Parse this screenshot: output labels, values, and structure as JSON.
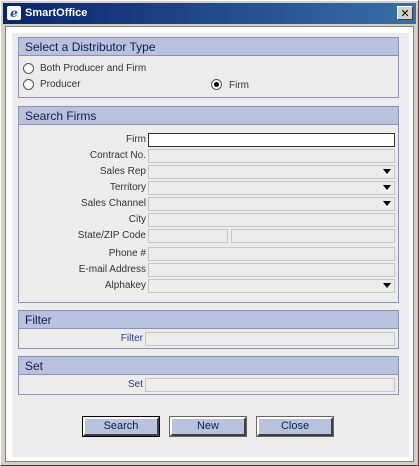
{
  "window": {
    "title": "SmartOffice",
    "close_glyph": "✕",
    "app_icon": "e"
  },
  "distributor": {
    "header": "Select a Distributor Type",
    "options": [
      {
        "label": "Both Producer and Firm",
        "checked": false
      },
      {
        "label": "Producer",
        "checked": false
      },
      {
        "label": "Firm",
        "checked": true
      }
    ]
  },
  "search": {
    "header": "Search Firms",
    "fields": {
      "firm": {
        "label": "Firm",
        "value": ""
      },
      "contract_no": {
        "label": "Contract No.",
        "value": ""
      },
      "sales_rep": {
        "label": "Sales Rep",
        "value": ""
      },
      "territory": {
        "label": "Territory",
        "value": ""
      },
      "sales_channel": {
        "label": "Sales Channel",
        "value": ""
      },
      "city": {
        "label": "City",
        "value": ""
      },
      "state_zip": {
        "label": "State/ZIP Code",
        "state": "",
        "zip": ""
      },
      "phone": {
        "label": "Phone #",
        "value": ""
      },
      "email": {
        "label": "E-mail Address",
        "value": ""
      },
      "alphakey": {
        "label": "Alphakey",
        "value": ""
      }
    }
  },
  "filter": {
    "header": "Filter",
    "label": "Filter",
    "value": ""
  },
  "set": {
    "header": "Set",
    "label": "Set",
    "value": ""
  },
  "buttons": {
    "search": "Search",
    "new": "New",
    "close": "Close"
  }
}
